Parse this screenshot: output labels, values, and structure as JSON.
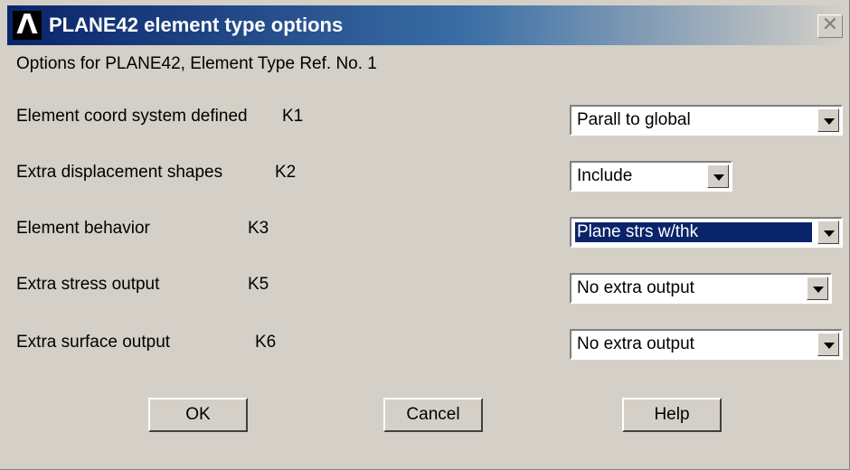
{
  "window": {
    "title": "PLANE42 element type options",
    "logo_glyph": "Λ",
    "close_glyph": "✕"
  },
  "subtitle": "Options for PLANE42, Element Type Ref. No. 1",
  "options": [
    {
      "label": "Element coord system defined",
      "key": "K1",
      "value": "Parall to global"
    },
    {
      "label": "Extra displacement shapes",
      "key": "K2",
      "value": "Include"
    },
    {
      "label": "Element behavior",
      "key": "K3",
      "value": "Plane strs w/thk"
    },
    {
      "label": "Extra stress output",
      "key": "K5",
      "value": "No extra output"
    },
    {
      "label": "Extra surface output",
      "key": "K6",
      "value": "No extra output"
    }
  ],
  "buttons": {
    "ok": "OK",
    "cancel": "Cancel",
    "help": "Help"
  },
  "colors": {
    "titlebar": "#0a246a",
    "dialog_bg": "#d4d0c8",
    "selection": "#0a246a"
  }
}
